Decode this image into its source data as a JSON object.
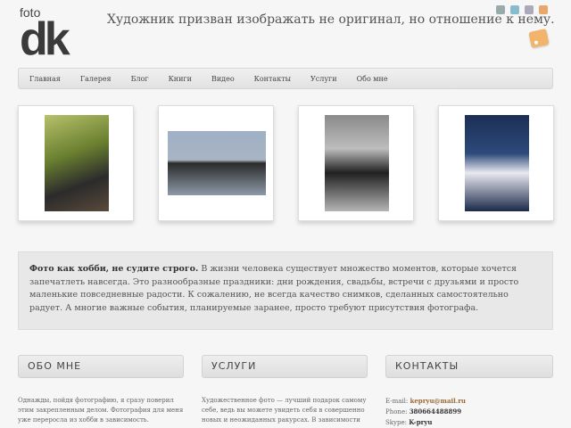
{
  "logo": {
    "small": "foto",
    "big": "dk"
  },
  "tagline": "Художник призван изображать не оригинал, но отношение к нему.",
  "social_icons": [
    "facebook-icon",
    "twitter-icon",
    "vk-icon",
    "rss-small-icon"
  ],
  "nav": {
    "items": [
      "Главная",
      "Галерея",
      "Блог",
      "Книги",
      "Видео",
      "Контакты",
      "Услуги",
      "Обо мне"
    ]
  },
  "photos": [
    {
      "alt": "girl-in-park"
    },
    {
      "alt": "girl-lying"
    },
    {
      "alt": "woman-hat"
    },
    {
      "alt": "child-portrait"
    }
  ],
  "intro": {
    "bold": "Фото как хобби, не судите строго.",
    "text": " В жизни человека существует множество моментов, которые хочется запечатлеть навсегда. Это разнообразные праздники: дни рождения, свадьбы, встречи с друзьями и просто маленькие повседневные радости. К сожалению, не всегда качество снимков, сделанных самостоятельно радует. А многие важные события, планируемые заранее, просто требуют присутствия фотографа."
  },
  "columns": [
    {
      "title": "ОБО МНЕ",
      "text": "Однажды, пойдя фотографию, я сразу поверил этим закрепленным делом. Фотография для меня уже переросла из хобби в зависимость."
    },
    {
      "title": "УСЛУГИ",
      "text": "Художественное фото — лучший подарок самому себе, ведь вы можете увидеть себя в совершенно новых и неожиданных ракурсах. В зависимости от"
    },
    {
      "title": "КОНТАКТЫ",
      "email_label": "E-mail:",
      "email": "kepryu@mail.ru",
      "phone_label": "Phone:",
      "phone": "380664488899",
      "skype_label": "Skype:",
      "skype": "K-pryu"
    }
  ]
}
